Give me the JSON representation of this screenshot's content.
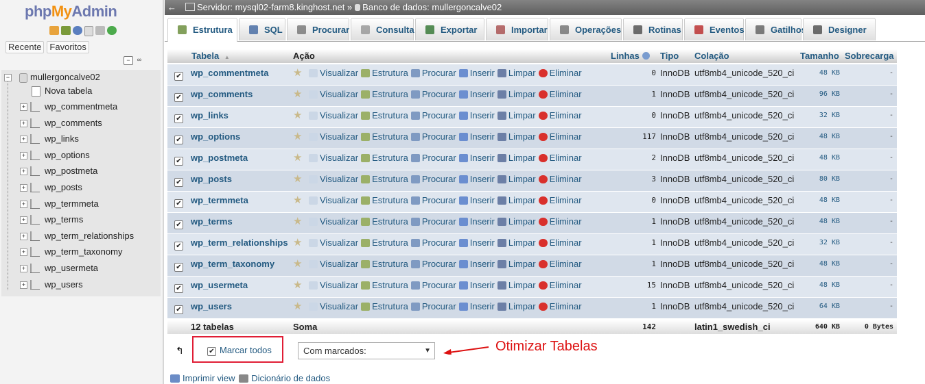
{
  "app": {
    "logo_php": "php",
    "logo_my": "My",
    "logo_admin": "Admin"
  },
  "nav": {
    "tabs": [
      "Recente",
      "Favoritos"
    ],
    "database": "mullergoncalve02",
    "new_table": "Nova tabela",
    "tables": [
      "wp_commentmeta",
      "wp_comments",
      "wp_links",
      "wp_options",
      "wp_postmeta",
      "wp_posts",
      "wp_termmeta",
      "wp_terms",
      "wp_term_relationships",
      "wp_term_taxonomy",
      "wp_usermeta",
      "wp_users"
    ]
  },
  "breadcrumb": {
    "server": "Servidor: mysql02-farm8.kinghost.net",
    "sep": "»",
    "database": "Banco de dados: mullergoncalve02"
  },
  "tabs": [
    {
      "label": "Estrutura",
      "icon": "structure-icon",
      "active": true
    },
    {
      "label": "SQL",
      "icon": "sql-icon"
    },
    {
      "label": "Procurar",
      "icon": "search-icon"
    },
    {
      "label": "Consulta",
      "icon": "query-icon"
    },
    {
      "label": "Exportar",
      "icon": "export-icon"
    },
    {
      "label": "Importar",
      "icon": "import-icon"
    },
    {
      "label": "Operações",
      "icon": "wrench-icon"
    },
    {
      "label": "Rotinas",
      "icon": "routines-icon"
    },
    {
      "label": "Eventos",
      "icon": "clock-icon"
    },
    {
      "label": "Gatilhos",
      "icon": "triggers-icon"
    },
    {
      "label": "Designer",
      "icon": "designer-icon"
    }
  ],
  "table_header": {
    "table": "Tabela",
    "sort": "▲",
    "action": "Ação",
    "rows": "Linhas",
    "type": "Tipo",
    "collation": "Colação",
    "size": "Tamanho",
    "overhead": "Sobrecarga"
  },
  "actions": [
    "Visualizar",
    "Estrutura",
    "Procurar",
    "Inserir",
    "Limpar",
    "Eliminar"
  ],
  "rows": [
    {
      "name": "wp_commentmeta",
      "rows": "0",
      "engine": "InnoDB",
      "collation": "utf8mb4_unicode_520_ci",
      "size": "48 KB",
      "overhead": "-"
    },
    {
      "name": "wp_comments",
      "rows": "1",
      "engine": "InnoDB",
      "collation": "utf8mb4_unicode_520_ci",
      "size": "96 KB",
      "overhead": "-"
    },
    {
      "name": "wp_links",
      "rows": "0",
      "engine": "InnoDB",
      "collation": "utf8mb4_unicode_520_ci",
      "size": "32 KB",
      "overhead": "-"
    },
    {
      "name": "wp_options",
      "rows": "117",
      "engine": "InnoDB",
      "collation": "utf8mb4_unicode_520_ci",
      "size": "48 KB",
      "overhead": "-"
    },
    {
      "name": "wp_postmeta",
      "rows": "2",
      "engine": "InnoDB",
      "collation": "utf8mb4_unicode_520_ci",
      "size": "48 KB",
      "overhead": "-"
    },
    {
      "name": "wp_posts",
      "rows": "3",
      "engine": "InnoDB",
      "collation": "utf8mb4_unicode_520_ci",
      "size": "80 KB",
      "overhead": "-"
    },
    {
      "name": "wp_termmeta",
      "rows": "0",
      "engine": "InnoDB",
      "collation": "utf8mb4_unicode_520_ci",
      "size": "48 KB",
      "overhead": "-"
    },
    {
      "name": "wp_terms",
      "rows": "1",
      "engine": "InnoDB",
      "collation": "utf8mb4_unicode_520_ci",
      "size": "48 KB",
      "overhead": "-"
    },
    {
      "name": "wp_term_relationships",
      "rows": "1",
      "engine": "InnoDB",
      "collation": "utf8mb4_unicode_520_ci",
      "size": "32 KB",
      "overhead": "-"
    },
    {
      "name": "wp_term_taxonomy",
      "rows": "1",
      "engine": "InnoDB",
      "collation": "utf8mb4_unicode_520_ci",
      "size": "48 KB",
      "overhead": "-"
    },
    {
      "name": "wp_usermeta",
      "rows": "15",
      "engine": "InnoDB",
      "collation": "utf8mb4_unicode_520_ci",
      "size": "48 KB",
      "overhead": "-"
    },
    {
      "name": "wp_users",
      "rows": "1",
      "engine": "InnoDB",
      "collation": "utf8mb4_unicode_520_ci",
      "size": "64 KB",
      "overhead": "-"
    }
  ],
  "footer": {
    "count": "12 tabelas",
    "sum": "Soma",
    "rows": "142",
    "collation": "latin1_swedish_ci",
    "size": "640 KB",
    "overhead": "0 Bytes"
  },
  "bulk": {
    "mark_all": "Marcar todos",
    "with_selected": "Com marcados:",
    "annotation": "Otimizar Tabelas"
  },
  "links": {
    "print": "Imprimir view",
    "dictionary": "Dicionário de dados"
  }
}
